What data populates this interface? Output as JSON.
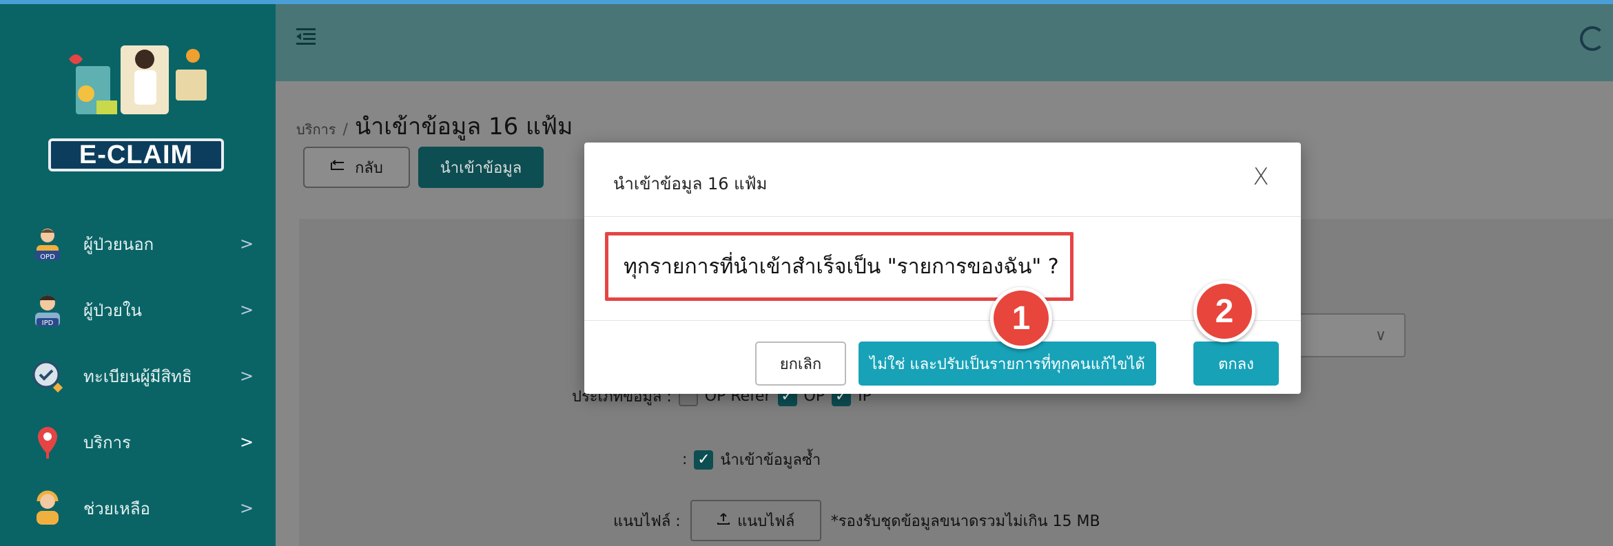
{
  "app": {
    "logo_text": "E-CLAIM"
  },
  "sidebar": {
    "items": [
      {
        "label": "ผู้ป่วยนอก",
        "icon": "opd-patient-icon",
        "badge": "OPD"
      },
      {
        "label": "ผู้ป่วยใน",
        "icon": "ipd-patient-icon",
        "badge": "IPD"
      },
      {
        "label": "ทะเบียนผู้มีสิทธิ",
        "icon": "eligibility-icon"
      },
      {
        "label": "บริการ",
        "icon": "location-pin-icon",
        "active": true
      },
      {
        "label": "ช่วยเหลือ",
        "icon": "help-agent-icon"
      }
    ],
    "chevron": ">"
  },
  "breadcrumb": {
    "parent": "บริการ",
    "separator": "/",
    "current": "นำเข้าข้อมูล 16 แฟ้ม"
  },
  "toolbar": {
    "back_label": "กลับ",
    "import_label": "นำเข้าข้อมูล"
  },
  "form": {
    "data_type_label": "ประเภทข้อมูล :",
    "data_types": [
      {
        "label": "OP Refer",
        "checked": false
      },
      {
        "label": "OP",
        "checked": true
      },
      {
        "label": "IP",
        "checked": true
      }
    ],
    "reimport_colon": ":",
    "reimport_label": "นำเข้าข้อมูลซ้ำ",
    "reimport_checked": true,
    "attach_label": "แนบไฟล์ :",
    "attach_button": "แนบไฟล์",
    "attach_note": "*รองรับชุดข้อมูลขนาดรวมไม่เกิน 15 MB",
    "select_chevron": "∨"
  },
  "modal": {
    "title": "นำเข้าข้อมูล 16 แฟ้ม",
    "close": "X",
    "question": "ทุกรายการที่นำเข้าสำเร็จเป็น \"รายการของฉัน\" ?",
    "cancel_label": "ยกเลิก",
    "no_label": "ไม่ใช่ และปรับเป็นรายการที่ทุกคนแก้ไขได้",
    "ok_label": "ตกลง"
  },
  "annotations": {
    "step1": "1",
    "step2": "2"
  },
  "colors": {
    "sidebar_bg": "#0a6466",
    "topbar_bg": "#4a7576",
    "primary_button": "#17a2b8",
    "highlight_red": "#e64444",
    "badge_red": "#e8453c"
  }
}
